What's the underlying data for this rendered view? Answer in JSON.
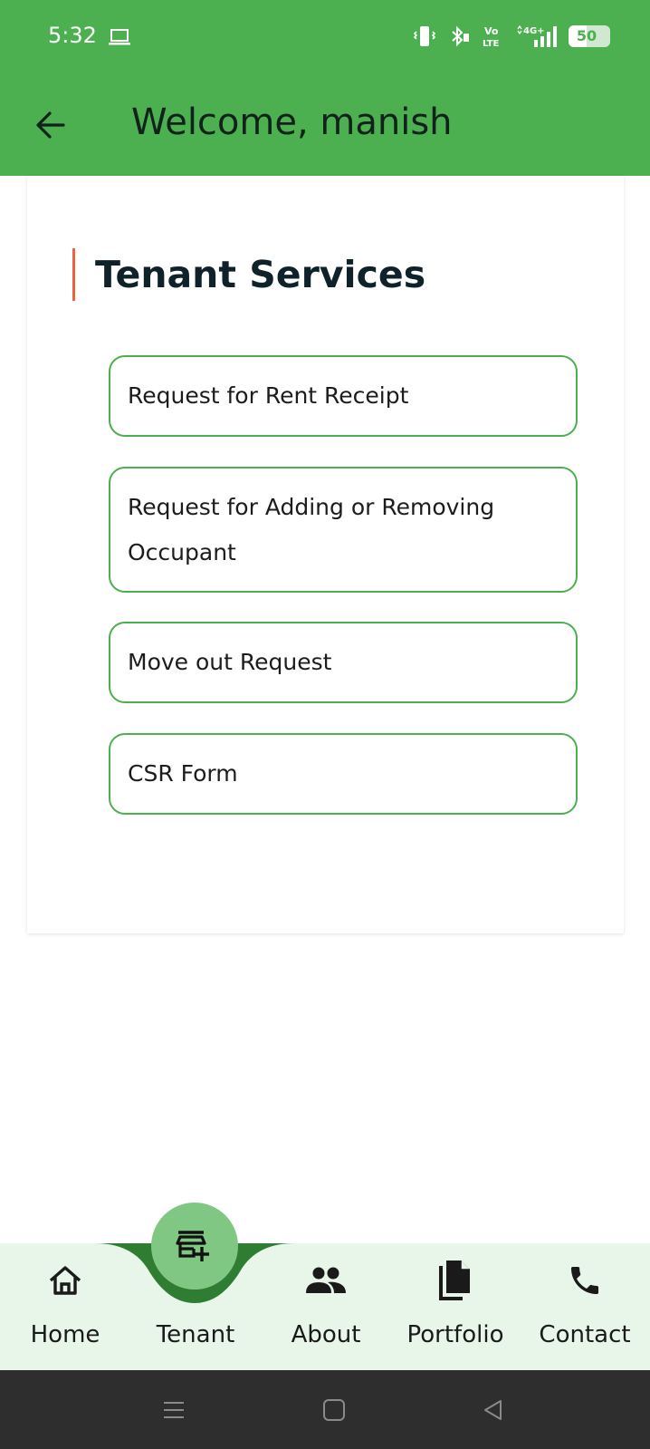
{
  "status_bar": {
    "time": "5:32",
    "battery_level": "50",
    "network_label": "4G+",
    "volte_label_top": "Vo",
    "volte_label_bottom": "LTE",
    "icons": [
      "laptop-icon",
      "vibrate-icon",
      "bluetooth-icon",
      "volte-icon",
      "signal-icon",
      "battery-icon"
    ]
  },
  "app_bar": {
    "back_icon": "arrow-left-icon",
    "title": "Welcome, manish"
  },
  "tenant_services": {
    "title": "Tenant Services",
    "accent_color": "#f0623e",
    "items": [
      {
        "label": "Request for Rent Receipt"
      },
      {
        "label": "Request for Adding or Removing Occupant"
      },
      {
        "label": "Move out Request"
      },
      {
        "label": "CSR Form"
      }
    ]
  },
  "bottom_nav": {
    "active_index": 1,
    "items": [
      {
        "label": "Home",
        "icon": "home-icon"
      },
      {
        "label": "Tenant",
        "icon": "store-add-icon"
      },
      {
        "label": "About",
        "icon": "people-icon"
      },
      {
        "label": "Portfolio",
        "icon": "documents-icon"
      },
      {
        "label": "Contact",
        "icon": "phone-icon"
      }
    ]
  },
  "system_nav": {
    "icons": [
      "menu-icon",
      "home-square-icon",
      "back-triangle-icon"
    ]
  },
  "colors": {
    "primary": "#4caf50",
    "dark_green": "#2e7d32",
    "fab": "#81c784",
    "nav_bg": "#e8f5e9"
  }
}
